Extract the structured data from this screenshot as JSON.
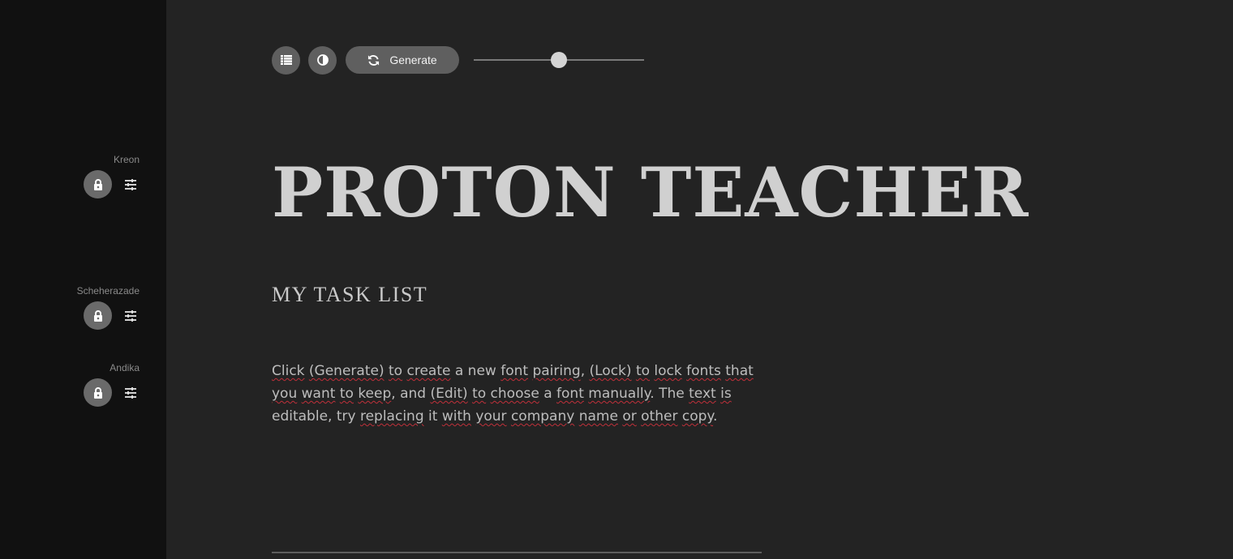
{
  "sidebar": {
    "fonts": [
      {
        "name": "Kreon",
        "lock_icon": "lock-icon",
        "edit_icon": "sliders-icon"
      },
      {
        "name": "Scheherazade",
        "lock_icon": "lock-icon",
        "edit_icon": "sliders-icon"
      },
      {
        "name": "Andika",
        "lock_icon": "lock-icon",
        "edit_icon": "sliders-icon"
      }
    ]
  },
  "toolbar": {
    "list_icon": "list-icon",
    "contrast_icon": "contrast-icon",
    "generate_label": "Generate",
    "generate_icon": "refresh-icon",
    "slider_value": 0.5
  },
  "content": {
    "headline": "PROTON TEACHER",
    "subheadline": "MY TASK LIST",
    "body_segments": [
      {
        "t": "Click",
        "u": true
      },
      {
        "t": " ",
        "u": false
      },
      {
        "t": "(Generate)",
        "u": true
      },
      {
        "t": " ",
        "u": false
      },
      {
        "t": "to",
        "u": true
      },
      {
        "t": " ",
        "u": false
      },
      {
        "t": "create",
        "u": true
      },
      {
        "t": " a new ",
        "u": false
      },
      {
        "t": "font",
        "u": true
      },
      {
        "t": " ",
        "u": false
      },
      {
        "t": "pairing",
        "u": true
      },
      {
        "t": ", ",
        "u": false
      },
      {
        "t": "(Lock)",
        "u": true
      },
      {
        "t": " ",
        "u": false
      },
      {
        "t": "to",
        "u": true
      },
      {
        "t": " ",
        "u": false
      },
      {
        "t": "lock",
        "u": true
      },
      {
        "t": " ",
        "u": false
      },
      {
        "t": "fonts",
        "u": true
      },
      {
        "t": " ",
        "u": false
      },
      {
        "t": "that",
        "u": true
      },
      {
        "t": " ",
        "u": false
      },
      {
        "t": "you",
        "u": true
      },
      {
        "t": " ",
        "u": false
      },
      {
        "t": "want",
        "u": true
      },
      {
        "t": " ",
        "u": false
      },
      {
        "t": "to",
        "u": true
      },
      {
        "t": " ",
        "u": false
      },
      {
        "t": "keep",
        "u": true
      },
      {
        "t": ", and ",
        "u": false
      },
      {
        "t": "(Edit)",
        "u": true
      },
      {
        "t": " ",
        "u": false
      },
      {
        "t": "to",
        "u": true
      },
      {
        "t": " ",
        "u": false
      },
      {
        "t": "choose",
        "u": true
      },
      {
        "t": " a ",
        "u": false
      },
      {
        "t": "font",
        "u": true
      },
      {
        "t": " ",
        "u": false
      },
      {
        "t": "manually",
        "u": true
      },
      {
        "t": ". The ",
        "u": false
      },
      {
        "t": "text",
        "u": true
      },
      {
        "t": " ",
        "u": false
      },
      {
        "t": "is",
        "u": true
      },
      {
        "t": " editable, try ",
        "u": false
      },
      {
        "t": "replacing",
        "u": true
      },
      {
        "t": " it ",
        "u": false
      },
      {
        "t": "with",
        "u": true
      },
      {
        "t": " ",
        "u": false
      },
      {
        "t": "your",
        "u": true
      },
      {
        "t": " ",
        "u": false
      },
      {
        "t": "company",
        "u": true
      },
      {
        "t": " ",
        "u": false
      },
      {
        "t": "name",
        "u": true
      },
      {
        "t": " ",
        "u": false
      },
      {
        "t": "or",
        "u": true
      },
      {
        "t": " ",
        "u": false
      },
      {
        "t": "other",
        "u": true
      },
      {
        "t": " ",
        "u": false
      },
      {
        "t": "copy",
        "u": true
      },
      {
        "t": ".",
        "u": false
      }
    ]
  },
  "colors": {
    "background": "#232323",
    "sidebar": "#111111",
    "spellcheck": "#c0303a"
  }
}
